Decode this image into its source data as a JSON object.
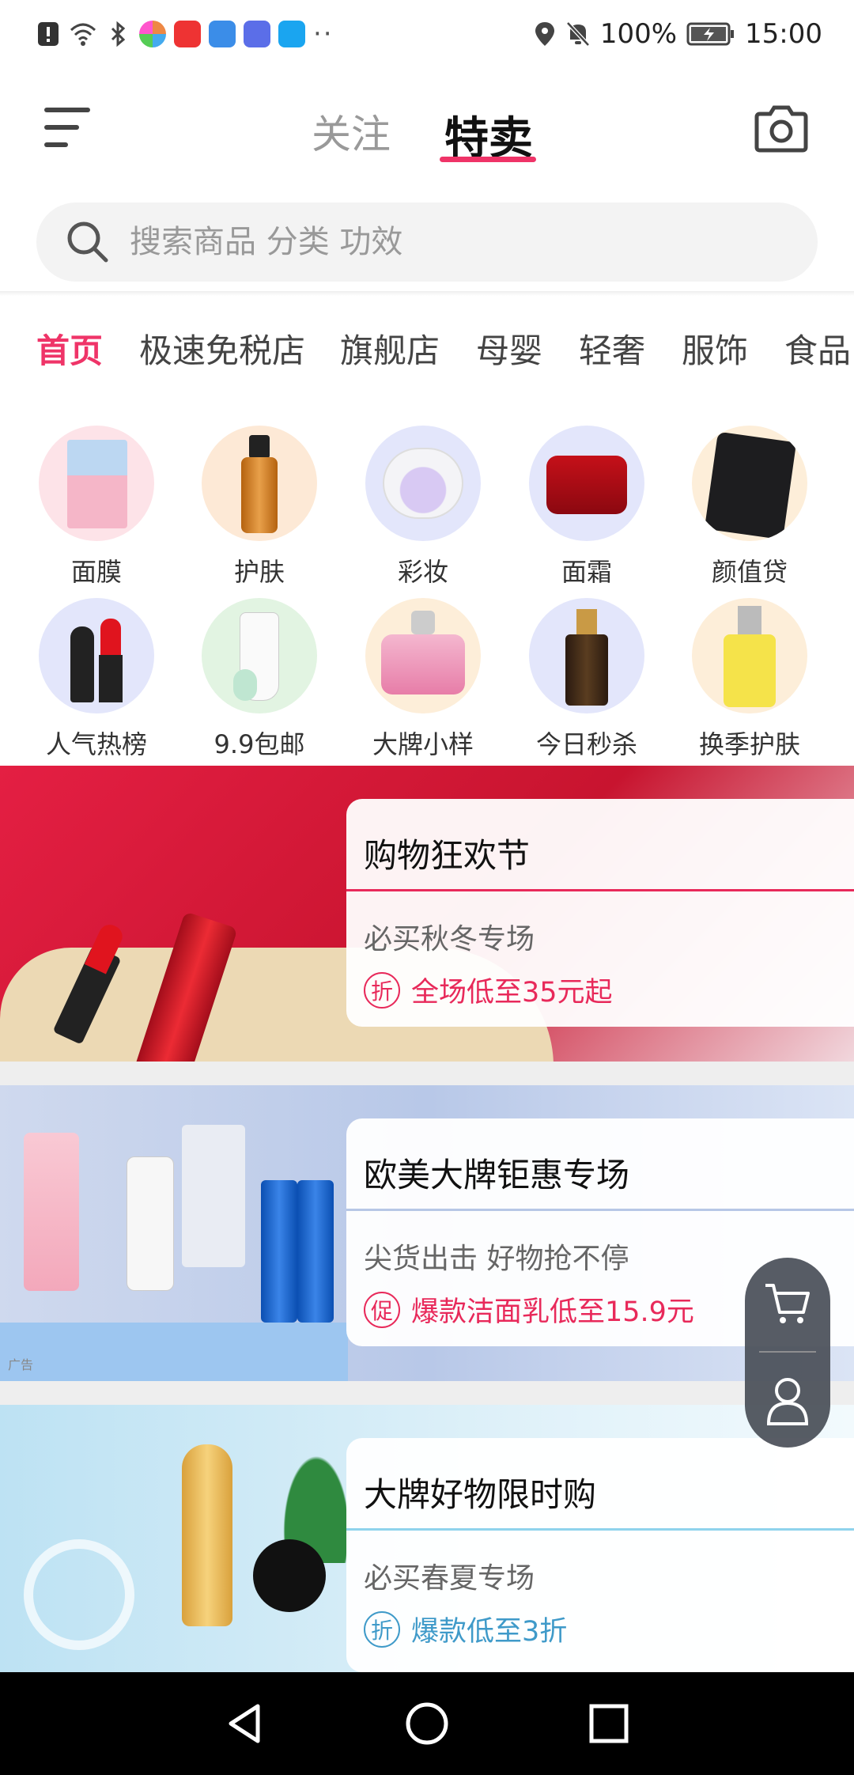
{
  "status_bar": {
    "battery": "100%",
    "time": "15:00",
    "dots": "··"
  },
  "header": {
    "tab_follow": "关注",
    "tab_special": "特卖"
  },
  "search": {
    "placeholder": "搜索商品 分类 功效"
  },
  "category_tabs": [
    "首页",
    "极速免税店",
    "旗舰店",
    "母婴",
    "轻奢",
    "服饰",
    "食品"
  ],
  "grid": {
    "row1": [
      "面膜",
      "护肤",
      "彩妆",
      "面霜",
      "颜值贷"
    ],
    "row2": [
      "人气热榜",
      "9.9包邮",
      "大牌小样",
      "今日秒杀",
      "换季护肤"
    ]
  },
  "banners": [
    {
      "title": "购物狂欢节",
      "subtitle": "必买秋冬专场",
      "badge": "折",
      "promo": "全场低至35元起",
      "accent": "#e8295a"
    },
    {
      "title": "欧美大牌钜惠专场",
      "subtitle": "尖货出击 好物抢不停",
      "badge": "促",
      "promo": "爆款洁面乳低至15.9元",
      "accent": "#e8295a",
      "ad_tag": "广告"
    },
    {
      "title": "大牌好物限时购",
      "subtitle": "必买春夏专场",
      "badge": "折",
      "promo": "爆款低至3折",
      "accent": "#3f9ac9"
    }
  ],
  "colors": {
    "brand_pink": "#ef3468"
  }
}
